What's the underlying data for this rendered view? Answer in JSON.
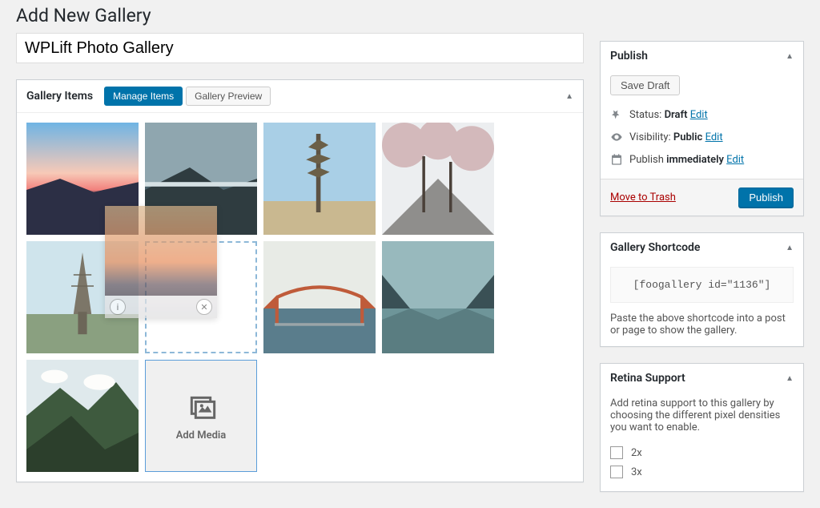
{
  "page_title": "Add New Gallery",
  "gallery_title": "WPLift Photo Gallery",
  "gallery_items_panel": {
    "title": "Gallery Items",
    "tabs": {
      "manage": "Manage Items",
      "preview": "Gallery Preview"
    },
    "add_media_label": "Add Media"
  },
  "publish": {
    "title": "Publish",
    "save_draft": "Save Draft",
    "status_label": "Status:",
    "status_value": "Draft",
    "visibility_label": "Visibility:",
    "visibility_value": "Public",
    "publish_label": "Publish",
    "publish_value": "immediately",
    "edit": "Edit",
    "trash": "Move to Trash",
    "publish_button": "Publish"
  },
  "shortcode": {
    "title": "Gallery Shortcode",
    "code": "[foogallery id=\"1136\"]",
    "hint": "Paste the above shortcode into a post or page to show the gallery."
  },
  "retina": {
    "title": "Retina Support",
    "hint": "Add retina support to this gallery by choosing the different pixel densities you want to enable.",
    "options": [
      "2x",
      "3x"
    ]
  }
}
